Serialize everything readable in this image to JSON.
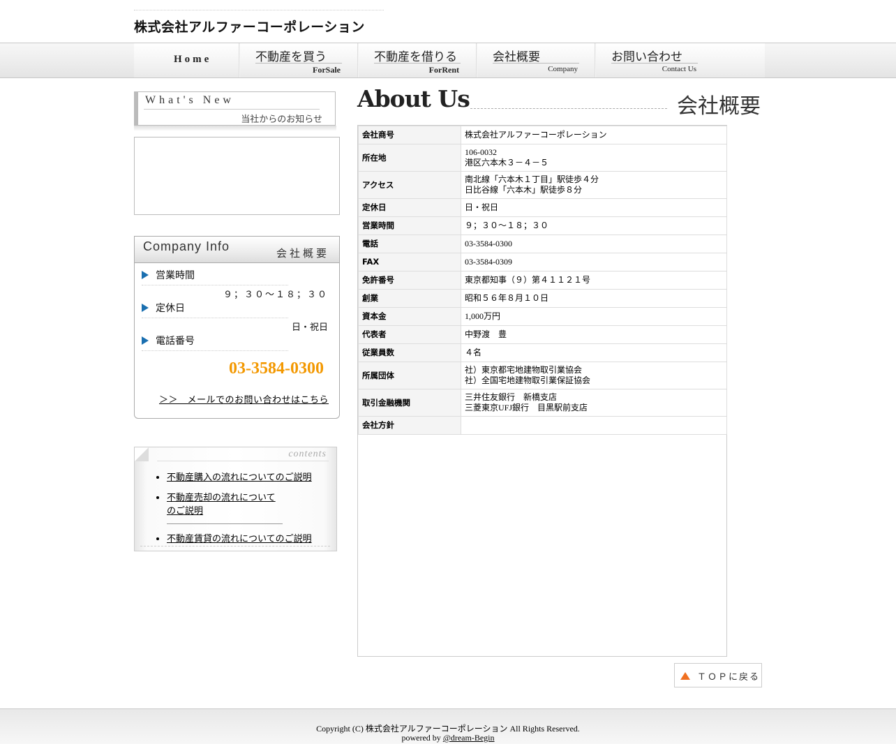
{
  "site": {
    "title": "株式会社アルファーコーポレーション"
  },
  "nav": {
    "home": "Home",
    "items": [
      {
        "jp": "不動産を買う",
        "en": "ForSale"
      },
      {
        "jp": "不動産を借りる",
        "en": "ForRent"
      },
      {
        "jp": "会社概要",
        "en": "Company"
      },
      {
        "jp": "お問い合わせ",
        "en": "Contact Us"
      }
    ]
  },
  "whats_new": {
    "title": "What's New",
    "subtitle": "当社からのお知らせ"
  },
  "company_info": {
    "title": "Company Info",
    "subtitle": "会社概要",
    "hours_label": "営業時間",
    "hours_value": "９；３０～１８；３０",
    "holiday_label": "定休日",
    "holiday_value": "日・祝日",
    "phone_label": "電話番号",
    "phone_value": "03-3584-0300",
    "mail_link": "＞＞　メールでのお問い合わせはこちら"
  },
  "contents": {
    "title": "contents",
    "links": [
      "不動産購入の流れについてのご説明",
      "不動産売却の流れについてのご説明",
      "不動産賃貸の流れについてのご説明"
    ]
  },
  "about": {
    "title": "About Us",
    "subtitle": "会社概要",
    "rows": [
      {
        "k": "会社商号",
        "v": [
          "株式会社アルファーコーポレーション"
        ]
      },
      {
        "k": "所在地",
        "v": [
          "106-0032",
          "港区六本木３－４－５"
        ]
      },
      {
        "k": "アクセス",
        "v": [
          "南北線「六本木１丁目」駅徒歩４分",
          "日比谷線「六本木」駅徒歩８分"
        ]
      },
      {
        "k": "定休日",
        "v": [
          "日・祝日"
        ]
      },
      {
        "k": "営業時間",
        "v": [
          "９；３０～１８；３０"
        ]
      },
      {
        "k": "電話",
        "v": [
          "03-3584-0300"
        ]
      },
      {
        "k": "FAX",
        "v": [
          "03-3584-0309"
        ]
      },
      {
        "k": "免許番号",
        "v": [
          "東京都知事（９）第４１１２１号"
        ]
      },
      {
        "k": "創業",
        "v": [
          "昭和５６年８月１０日"
        ]
      },
      {
        "k": "資本金",
        "v": [
          "1,000万円"
        ]
      },
      {
        "k": "代表者",
        "v": [
          "中野渡　豊"
        ]
      },
      {
        "k": "従業員数",
        "v": [
          "４名"
        ]
      },
      {
        "k": "所属団体",
        "v": [
          "社）東京都宅地建物取引業協会",
          "社）全国宅地建物取引業保証協会"
        ]
      },
      {
        "k": "取引金融機関",
        "v": [
          "三井住友銀行　新橋支店",
          "三菱東京UFJ銀行　目黒駅前支店"
        ]
      },
      {
        "k": "会社方針",
        "v": [
          ""
        ]
      }
    ]
  },
  "top_button": "ＴＯＰに戻る",
  "footer": {
    "copyright": "Copyright (C) 株式会社アルファーコーポレーション All Rights Reserved.",
    "powered_prefix": "powered by ",
    "powered_link": "@dream-Begin"
  }
}
